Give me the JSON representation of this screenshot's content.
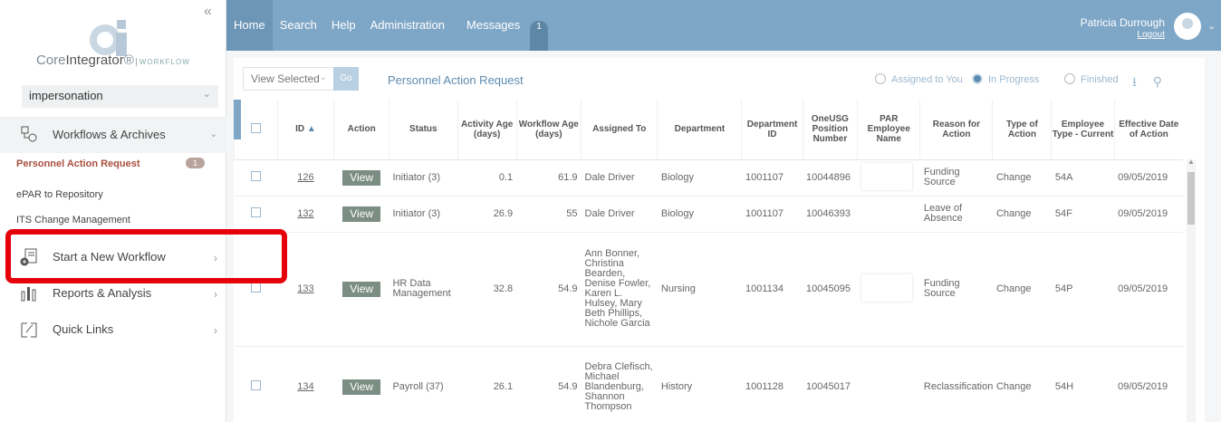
{
  "logo": {
    "brand_light": "Core",
    "brand_bold": "Integrator",
    "reg": "®",
    "suffix": "WORKFLOW",
    "mark": "ci"
  },
  "sidebar": {
    "impersonation": "impersonation",
    "workflows": "Workflows & Archives",
    "sub_items": [
      {
        "label": "Personnel Action Request",
        "badge": "1"
      },
      {
        "label": "ePAR to Repository"
      },
      {
        "label": "ITS Change Management"
      }
    ],
    "start": "Start a New Workflow",
    "reports": "Reports & Analysis",
    "quick_links": "Quick Links"
  },
  "topbar": {
    "menu": [
      "Home",
      "Search",
      "Help",
      "Administration",
      "Messages"
    ],
    "messages_count": "1",
    "user": "Patricia Durrough",
    "logout": "Logout"
  },
  "toolbar": {
    "view_select": "View Selected",
    "go": "Go",
    "title": "Personnel Action Request",
    "radios": [
      "Assigned to You",
      "In Progress",
      "Finished"
    ],
    "selected_radio": "In Progress"
  },
  "table": {
    "headers": [
      "ID",
      "Action",
      "Status",
      "Activity Age (days)",
      "Workflow Age (days)",
      "Assigned To",
      "Department",
      "Department ID",
      "OneUSG Position Number",
      "PAR Employee Name",
      "Reason for Action",
      "Type of Action",
      "Employee Type - Current",
      "Effective Date of Action"
    ],
    "rows": [
      {
        "id": "126",
        "action": "View",
        "status": "Initiator (3)",
        "activity_age": "0.1",
        "workflow_age": "61.9",
        "assigned_to": "Dale Driver",
        "department": "Biology",
        "dept_id": "1001107",
        "position": "10044896",
        "employee": "",
        "reason": "Funding Source",
        "type": "Change",
        "emp_type": "54A",
        "effective": "09/05/2019"
      },
      {
        "id": "132",
        "action": "View",
        "status": "Initiator (3)",
        "activity_age": "26.9",
        "workflow_age": "55",
        "assigned_to": "Dale Driver",
        "department": "Biology",
        "dept_id": "1001107",
        "position": "10046393",
        "employee": "",
        "reason": "Leave of Absence",
        "type": "Change",
        "emp_type": "54F",
        "effective": "09/05/2019"
      },
      {
        "id": "133",
        "action": "View",
        "status": "HR Data Management",
        "activity_age": "32.8",
        "workflow_age": "54.9",
        "assigned_to": "Ann Bonner, Christina Bearden, Denise Fowler, Karen L. Hulsey, Mary Beth Phillips, Nichole Garcia",
        "department": "Nursing",
        "dept_id": "1001134",
        "position": "10045095",
        "employee": "",
        "reason": "Funding Source",
        "type": "Change",
        "emp_type": "54P",
        "effective": "09/05/2019"
      },
      {
        "id": "134",
        "action": "View",
        "status": "Payroll (37)",
        "activity_age": "26.1",
        "workflow_age": "54.9",
        "assigned_to": "Debra Clefisch, Michael Blandenburg, Shannon Thompson",
        "department": "History",
        "dept_id": "1001128",
        "position": "10045017",
        "employee": "",
        "reason": "Reclassification",
        "type": "Change",
        "emp_type": "54H",
        "effective": "09/05/2019"
      }
    ]
  },
  "colors": {
    "topbar": "#7ea6c6",
    "accent": "#5d8bb0",
    "highlight": "#e6000a",
    "view_button": "#7c8d83"
  }
}
